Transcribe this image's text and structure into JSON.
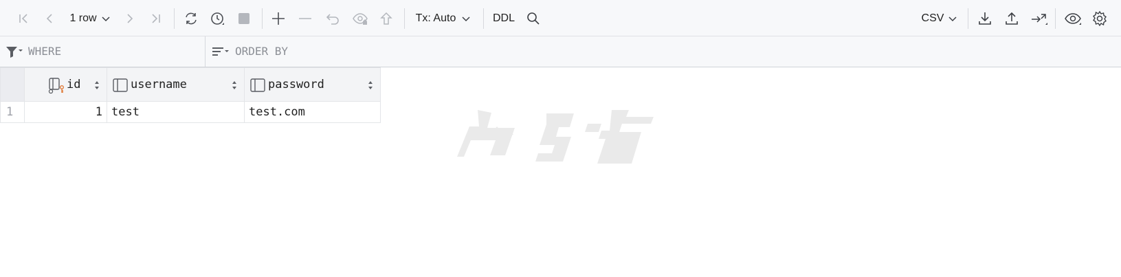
{
  "toolbar": {
    "row_count": "1 row",
    "tx_mode": "Tx: Auto",
    "ddl_label": "DDL",
    "export_format": "CSV",
    "icons": [
      "first-page-icon",
      "prev-page-icon",
      "next-page-icon",
      "last-page-icon",
      "refresh-icon",
      "history-icon",
      "stop-icon",
      "add-row-icon",
      "delete-row-icon",
      "revert-icon",
      "preview-icon",
      "submit-icon",
      "search-icon",
      "download-icon",
      "upload-icon",
      "compare-icon",
      "view-icon",
      "settings-icon"
    ]
  },
  "filters": {
    "where_placeholder": "WHERE",
    "order_by_placeholder": "ORDER BY"
  },
  "table": {
    "columns": [
      {
        "name": "id",
        "icon": "primary-key-column-icon"
      },
      {
        "name": "username",
        "icon": "column-icon"
      },
      {
        "name": "password",
        "icon": "column-icon"
      }
    ],
    "rows": [
      {
        "num": "1",
        "id": "1",
        "username": "test",
        "password": "test.com"
      }
    ]
  },
  "colors": {
    "toolbar_bg": "#f7f8fa",
    "header_bg": "#f3f4f6",
    "key_accent": "#e07b39"
  }
}
